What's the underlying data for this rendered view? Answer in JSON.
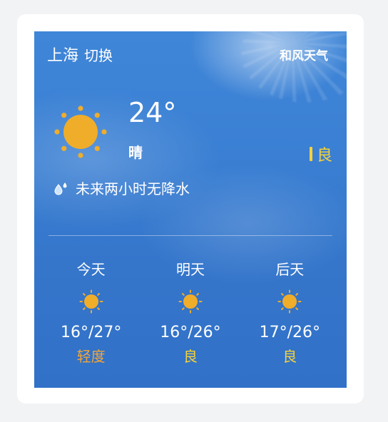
{
  "header": {
    "city": "上海",
    "switch_label": "切换",
    "brand": "和风天气"
  },
  "current": {
    "temperature": "24°",
    "condition": "晴",
    "aqi": "良",
    "aqi_color": "#f5d23a",
    "icon": "sun-icon",
    "rain_text": "未来两小时无降水",
    "rain_icon": "raindrop-icon"
  },
  "forecast": [
    {
      "label": "今天",
      "range": "16°/27°",
      "aqi": "轻度",
      "aqi_color": "#f2a53a",
      "icon": "sun-icon"
    },
    {
      "label": "明天",
      "range": "16°/26°",
      "aqi": "良",
      "aqi_color": "#f5d23a",
      "icon": "sun-icon"
    },
    {
      "label": "后天",
      "range": "17°/26°",
      "aqi": "良",
      "aqi_color": "#f5d23a",
      "icon": "sun-icon"
    }
  ],
  "colors": {
    "sun": "#f0ad2a",
    "sky": "#3a7fd3"
  }
}
